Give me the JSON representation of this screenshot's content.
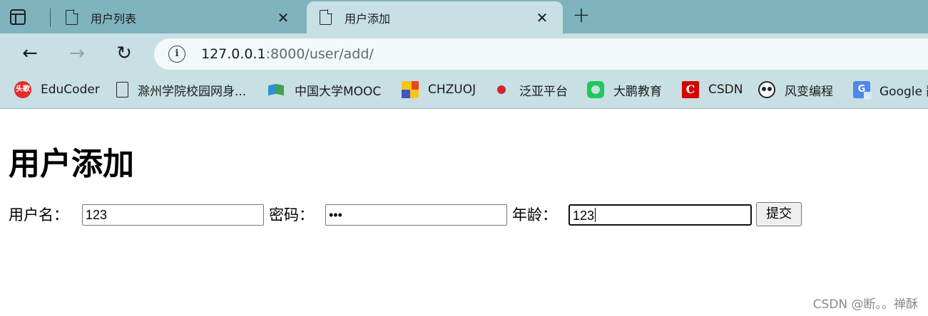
{
  "browser": {
    "tabs": [
      {
        "title": "用户列表",
        "active": false
      },
      {
        "title": "用户添加",
        "active": true
      }
    ],
    "close_glyph": "✕",
    "new_tab_glyph": "+",
    "nav": {
      "back": "←",
      "forward": "→",
      "reload": "↻"
    },
    "address": {
      "info_glyph": "i",
      "host": "127.0.0.1",
      "rest": ":8000/user/add/"
    },
    "bookmarks": [
      {
        "label": "EduCoder",
        "icon": "educoder-icon",
        "glyph": "头歌"
      },
      {
        "label": "滁州学院校园网身...",
        "icon": "document-icon",
        "glyph": ""
      },
      {
        "label": "中国大学MOOC",
        "icon": "mooc-icon",
        "glyph": ""
      },
      {
        "label": "CHZUOJ",
        "icon": "chzuoj-icon",
        "glyph": ""
      },
      {
        "label": "泛亚平台",
        "icon": "fanya-icon",
        "glyph": ""
      },
      {
        "label": "大鹏教育",
        "icon": "dapeng-icon",
        "glyph": ""
      },
      {
        "label": "CSDN",
        "icon": "csdn-icon",
        "glyph": "C"
      },
      {
        "label": "风变编程",
        "icon": "panda-icon",
        "glyph": ""
      },
      {
        "label": "Google 翻",
        "icon": "google-translate-icon",
        "glyph": "G"
      }
    ]
  },
  "page": {
    "title": "用户添加",
    "form": {
      "username_label": "用户名：",
      "username_value": "123",
      "password_label": "密码：",
      "password_value": "•••",
      "age_label": "年龄：",
      "age_value": "123",
      "submit_label": "提交"
    }
  },
  "watermark": "CSDN @断。。禅酥"
}
